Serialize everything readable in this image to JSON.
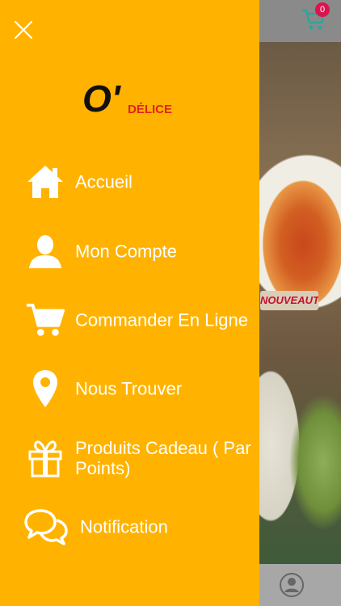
{
  "header": {
    "cart_count": "0"
  },
  "background": {
    "banner_text": "NOUVEAUTÉS"
  },
  "drawer": {
    "logo_text_o": "O'",
    "logo_text_delice": "DÉLICE",
    "menu": [
      {
        "label": "Accueil",
        "icon": "home-icon"
      },
      {
        "label": "Mon Compte",
        "icon": "user-icon"
      },
      {
        "label": "Commander En Ligne",
        "icon": "cart-icon"
      },
      {
        "label": "Nous Trouver",
        "icon": "location-pin-icon"
      },
      {
        "label": "Produits Cadeau ( Par Points)",
        "icon": "gift-icon"
      },
      {
        "label": "Notification",
        "icon": "chat-bubbles-icon"
      }
    ]
  },
  "colors": {
    "drawer_bg": "#ffb300",
    "badge": "#d8154f",
    "cart_icon": "#2aa59a",
    "logo_dark": "#111111",
    "logo_red": "#e0241b"
  }
}
